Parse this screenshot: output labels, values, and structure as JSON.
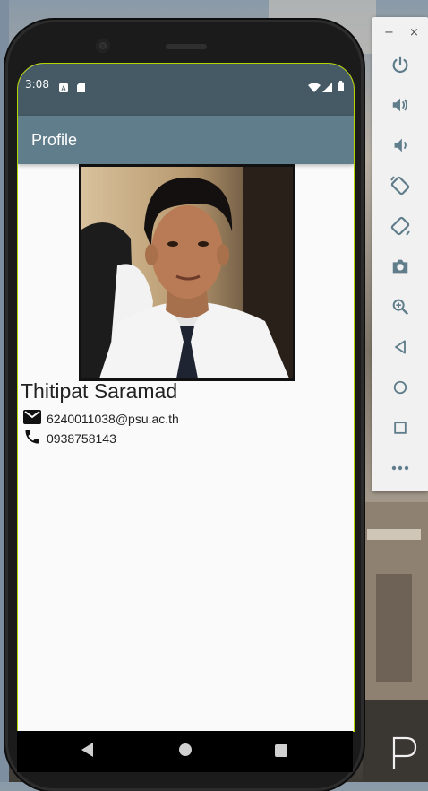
{
  "status_bar": {
    "time": "3:08"
  },
  "app_bar": {
    "title": "Profile"
  },
  "profile": {
    "name": "Thitipat Saramad",
    "email": "6240011038@psu.ac.th",
    "phone": "0938758143"
  },
  "emulator_panel": {
    "window_controls": [
      "minimize-icon",
      "close-icon"
    ],
    "tools": [
      "power-icon",
      "volume-up-icon",
      "volume-down-icon",
      "rotate-left-icon",
      "rotate-right-icon",
      "camera-icon",
      "zoom-icon",
      "back-icon",
      "home-icon",
      "overview-icon",
      "more-icon"
    ]
  },
  "colors": {
    "status_bar": "#455a64",
    "app_bar": "#607d8b",
    "screen_bg": "#fafafa",
    "phone_body": "#1b1b1b"
  }
}
